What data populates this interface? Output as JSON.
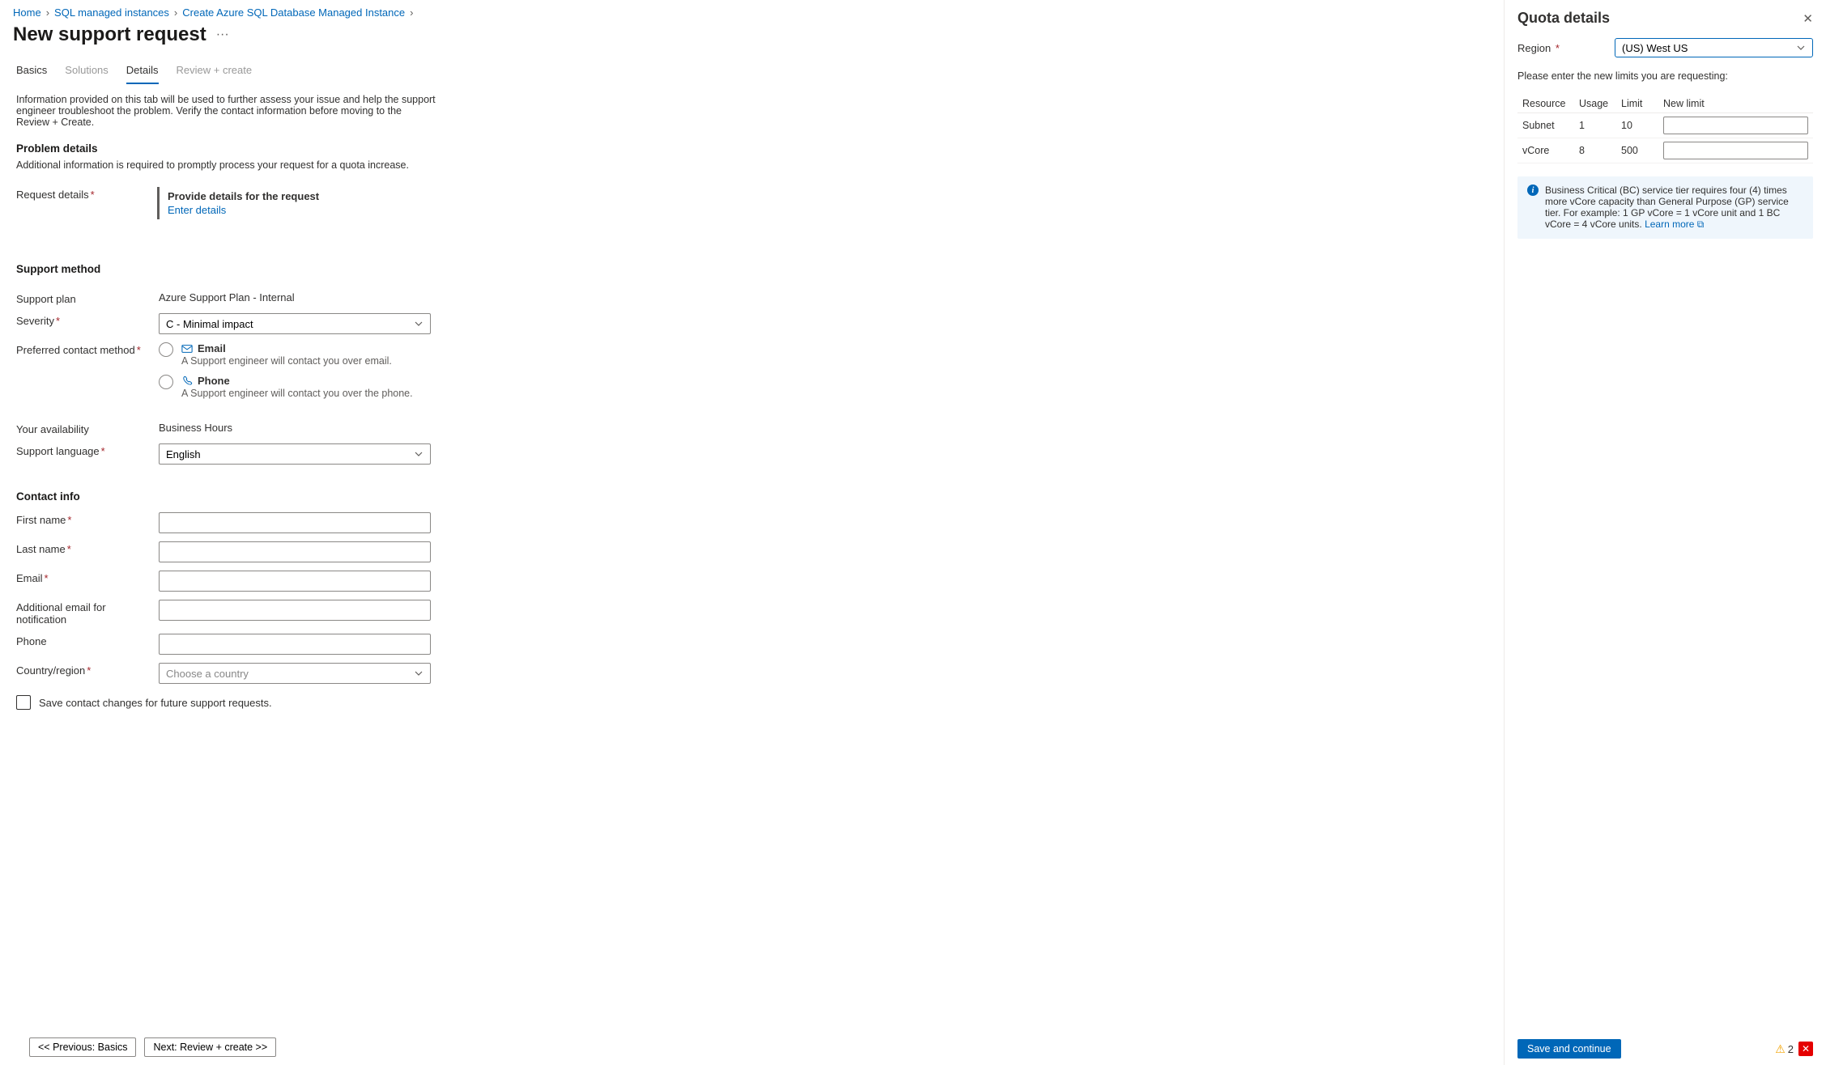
{
  "breadcrumb": [
    "Home",
    "SQL managed instances",
    "Create Azure SQL Database Managed Instance"
  ],
  "page_title": "New support request",
  "tabs": {
    "basics": "Basics",
    "solutions": "Solutions",
    "details": "Details",
    "review": "Review + create"
  },
  "intro": "Information provided on this tab will be used to further assess your issue and help the support engineer troubleshoot the problem. Verify the contact information before moving to the Review + Create.",
  "sections": {
    "problem": {
      "heading": "Problem details",
      "sub": "Additional information is required to promptly process your request for a quota increase.",
      "request_details_label": "Request details",
      "callout_title": "Provide details for the request",
      "callout_link": "Enter details"
    },
    "support": {
      "heading": "Support method",
      "plan_label": "Support plan",
      "plan_value": "Azure Support Plan - Internal",
      "severity_label": "Severity",
      "severity_value": "C - Minimal impact",
      "contact_label": "Preferred contact method",
      "contact_options": {
        "email_label": "Email",
        "email_sub": "A Support engineer will contact you over email.",
        "phone_label": "Phone",
        "phone_sub": "A Support engineer will contact you over the phone."
      },
      "availability_label": "Your availability",
      "availability_value": "Business Hours",
      "language_label": "Support language",
      "language_value": "English"
    },
    "contact": {
      "heading": "Contact info",
      "first_name": "First name",
      "last_name": "Last name",
      "email": "Email",
      "additional_email": "Additional email for notification",
      "phone": "Phone",
      "country": "Country/region",
      "country_placeholder": "Choose a country",
      "save_checkbox": "Save contact changes for future support requests."
    }
  },
  "footer": {
    "prev": "<< Previous: Basics",
    "next": "Next: Review + create >>"
  },
  "panel": {
    "title": "Quota details",
    "region_label": "Region",
    "region_value": "(US) West US",
    "note": "Please enter the new limits you are requesting:",
    "table": {
      "headers": {
        "resource": "Resource",
        "usage": "Usage",
        "limit": "Limit",
        "new_limit": "New limit"
      },
      "rows": [
        {
          "resource": "Subnet",
          "usage": "1",
          "limit": "10"
        },
        {
          "resource": "vCore",
          "usage": "8",
          "limit": "500"
        }
      ]
    },
    "info": "Business Critical (BC) service tier requires four (4) times more vCore capacity than General Purpose (GP) service tier. For example: 1 GP vCore = 1 vCore unit and 1 BC vCore = 4 vCore units. ",
    "learn_more": "Learn more",
    "save": "Save and continue",
    "warn_count": "2"
  }
}
